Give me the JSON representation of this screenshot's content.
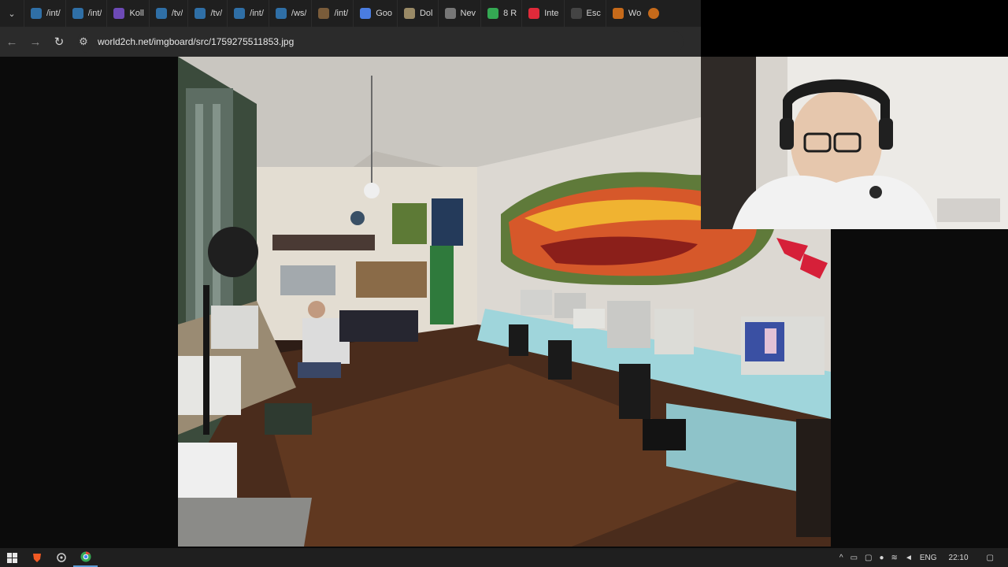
{
  "browser": {
    "tabs": [
      {
        "label": "/int/",
        "icon": "4chan-icon",
        "color": "#2f6fa6"
      },
      {
        "label": "/int/",
        "icon": "4chan-icon",
        "color": "#2f6fa6"
      },
      {
        "label": "Koll",
        "icon": "k-icon",
        "color": "#6d4ab6"
      },
      {
        "label": "/tv/",
        "icon": "4chan-icon",
        "color": "#2f6fa6"
      },
      {
        "label": "/tv/",
        "icon": "4chan-icon",
        "color": "#2f6fa6"
      },
      {
        "label": "/int/",
        "icon": "4chan-icon",
        "color": "#2f6fa6"
      },
      {
        "label": "/ws/",
        "icon": "4chan-icon",
        "color": "#2f6fa6"
      },
      {
        "label": "/int/",
        "icon": "avatar-icon",
        "color": "#7a5c3a"
      },
      {
        "label": "Goo",
        "icon": "google-translate-icon",
        "color": "#4a7de1"
      },
      {
        "label": "Dol",
        "icon": "coin-icon",
        "color": "#9a8a66"
      },
      {
        "label": "Nev",
        "icon": "globe-icon",
        "color": "#777777"
      },
      {
        "label": "8 R",
        "icon": "map-pin-icon",
        "color": "#34a853"
      },
      {
        "label": "Inte",
        "icon": "q-icon",
        "color": "#e02a3a"
      },
      {
        "label": "Esc",
        "icon": "e-icon",
        "color": "#444444"
      },
      {
        "label": "Wo",
        "icon": "ball-icon",
        "color": "#c66a1a"
      }
    ],
    "url": "world2ch.net/imgboard/src/1759275511853.jpg"
  },
  "taskbar": {
    "language": "ENG",
    "time": "22:10"
  }
}
